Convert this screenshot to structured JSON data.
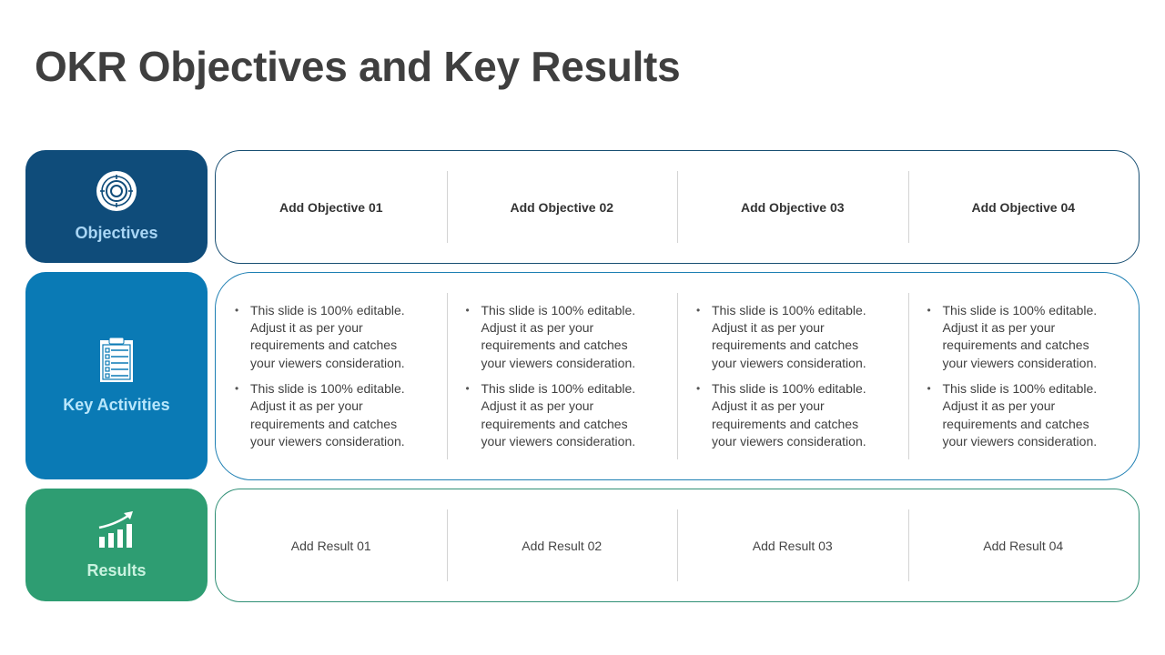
{
  "title": "OKR Objectives and Key Results",
  "colors": {
    "objectives": "#0f4c7a",
    "key_activities": "#0a7ab5",
    "results": "#2e9d72"
  },
  "rows": {
    "objectives": {
      "label": "Objectives",
      "icon": "target-icon",
      "cells": [
        "Add Objective 01",
        "Add Objective 02",
        "Add Objective 03",
        "Add Objective 04"
      ]
    },
    "key_activities": {
      "label": "Key Activities",
      "icon": "clipboard-checklist-icon",
      "cells": [
        [
          "This slide is 100% editable. Adjust it as per your requirements and catches your viewers consideration.",
          "This slide is 100% editable. Adjust it as per your requirements and catches your viewers consideration."
        ],
        [
          "This slide is 100% editable. Adjust it as per your requirements and catches your viewers consideration.",
          "This slide is 100% editable. Adjust it as per your requirements and catches your viewers consideration."
        ],
        [
          "This slide is 100% editable. Adjust it as per your requirements and catches your viewers consideration.",
          "This slide is 100% editable. Adjust it as per your requirements and catches your viewers consideration."
        ],
        [
          "This slide is 100% editable. Adjust it as per your requirements and catches your viewers consideration.",
          "This slide is 100% editable. Adjust it as per your requirements and catches your viewers consideration."
        ]
      ]
    },
    "results": {
      "label": "Results",
      "icon": "growth-chart-icon",
      "cells": [
        "Add Result 01",
        "Add Result 02",
        "Add Result 03",
        "Add Result 04"
      ]
    }
  }
}
